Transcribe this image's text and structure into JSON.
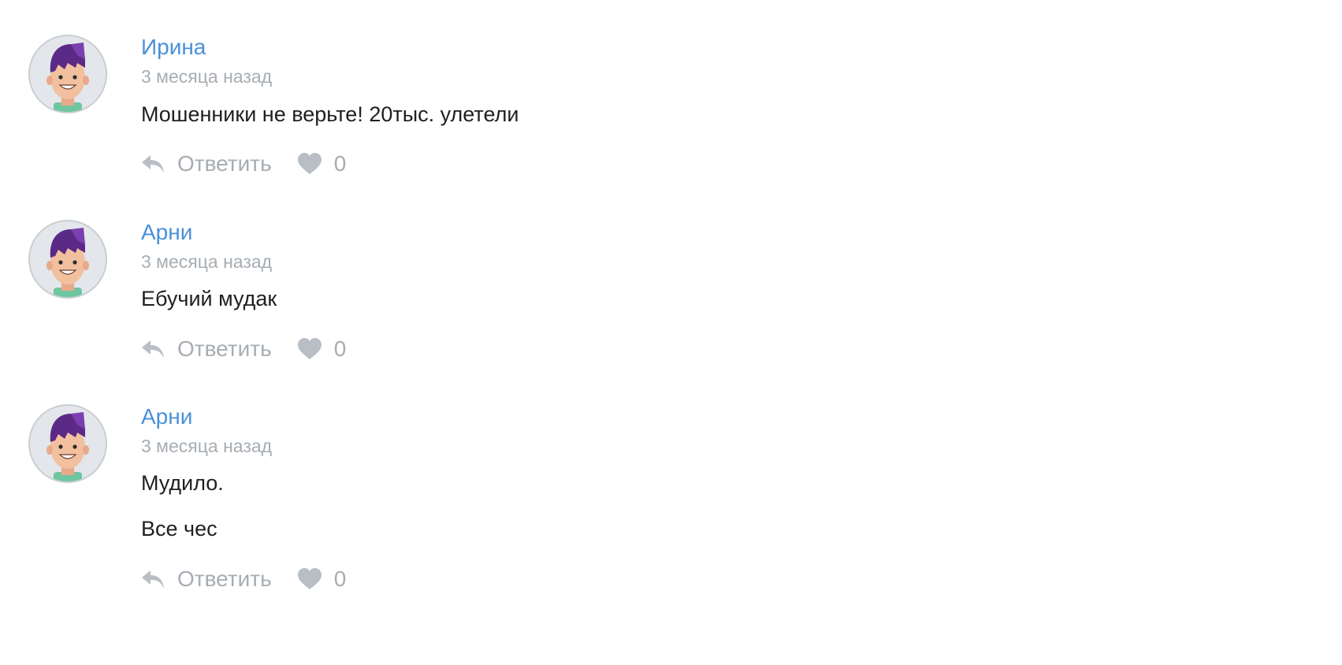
{
  "colors": {
    "author": "#4a90d9",
    "muted": "#a7adb3",
    "text": "#1f1f1f",
    "icon": "#b8bec4"
  },
  "avatar_icon": "cartoon-man-avatar",
  "reply_icon": "reply-arrow-icon",
  "like_icon": "heart-icon",
  "comments": [
    {
      "author": "Ирина",
      "time": "3 месяца назад",
      "lines": [
        "Мошенники не верьте! 20тыс. улетели"
      ],
      "reply_label": "Ответить",
      "likes": "0"
    },
    {
      "author": "Арни",
      "time": "3 месяца назад",
      "lines": [
        "Ебучий мудак"
      ],
      "reply_label": "Ответить",
      "likes": "0"
    },
    {
      "author": "Арни",
      "time": "3 месяца назад",
      "lines": [
        "Мудило.",
        "Все чес"
      ],
      "reply_label": "Ответить",
      "likes": "0"
    }
  ]
}
